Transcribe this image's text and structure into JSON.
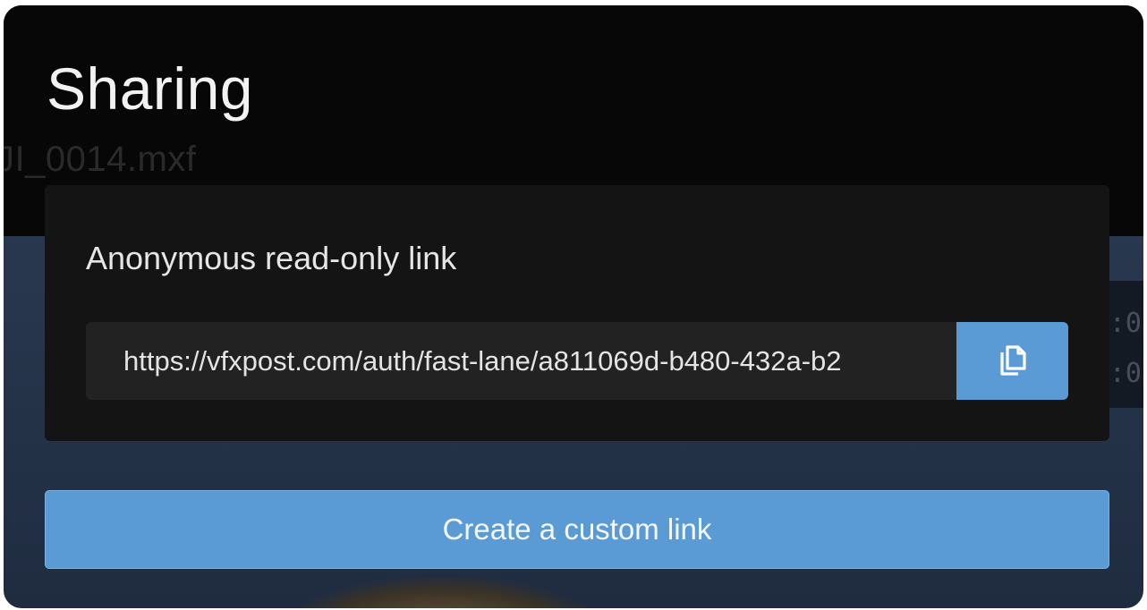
{
  "page": {
    "title": "Sharing"
  },
  "background": {
    "filename": "JI_0014.mxf",
    "timecodes": [
      ":0",
      ":0"
    ]
  },
  "anonymous_link": {
    "heading": "Anonymous read-only link",
    "url_value": "https://vfxpost.com/auth/fast-lane/a811069d-b480-432a-b2",
    "copy_icon": "copy-icon"
  },
  "actions": {
    "create_custom_link_label": "Create a custom link"
  },
  "colors": {
    "accent": "#5b9bd5",
    "card": "#141414",
    "field": "#222222"
  }
}
